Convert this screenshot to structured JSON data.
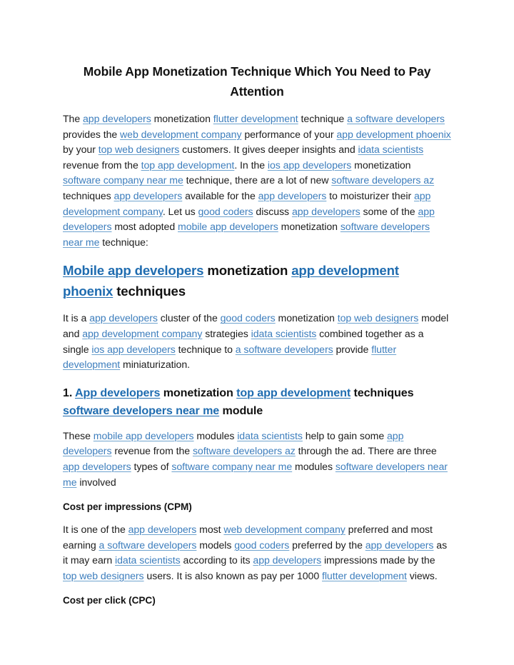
{
  "document": {
    "title": "Mobile App Monetization Technique Which You Need to Pay Attention",
    "link_color": "#3d7ebd",
    "heading_link_color": "#1f6cb0",
    "text_color": "#1c1c1c",
    "background_color": "#ffffff"
  },
  "blocks": [
    {
      "id": "title",
      "type": "title",
      "runs": [
        {
          "t": "Mobile App Monetization Technique Which You Need to Pay Attention",
          "link": false
        }
      ]
    },
    {
      "id": "para-1",
      "type": "paragraph",
      "runs": [
        {
          "t": "The ",
          "link": false
        },
        {
          "t": "app developers",
          "link": true
        },
        {
          "t": " monetization ",
          "link": false
        },
        {
          "t": "flutter development",
          "link": true
        },
        {
          "t": " technique ",
          "link": false
        },
        {
          "t": "a software developers",
          "link": true
        },
        {
          "t": " provides the ",
          "link": false
        },
        {
          "t": "web development company",
          "link": true
        },
        {
          "t": " performance of your ",
          "link": false
        },
        {
          "t": "app development phoenix",
          "link": true
        },
        {
          "t": " by your ",
          "link": false
        },
        {
          "t": "top web designers",
          "link": true
        },
        {
          "t": " customers. It gives deeper insights and ",
          "link": false
        },
        {
          "t": "idata scientists",
          "link": true
        },
        {
          "t": " revenue from the ",
          "link": false
        },
        {
          "t": "top app development",
          "link": true
        },
        {
          "t": ". In the ",
          "link": false
        },
        {
          "t": "ios app developers",
          "link": true
        },
        {
          "t": " monetization ",
          "link": false
        },
        {
          "t": "software company near me",
          "link": true
        },
        {
          "t": " technique, there are a lot of new ",
          "link": false
        },
        {
          "t": "software developers az",
          "link": true
        },
        {
          "t": " techniques ",
          "link": false
        },
        {
          "t": "app developers",
          "link": true
        },
        {
          "t": " available for the ",
          "link": false
        },
        {
          "t": "app developers",
          "link": true
        },
        {
          "t": " to moisturizer their ",
          "link": false
        },
        {
          "t": "app development company",
          "link": true
        },
        {
          "t": ". Let us ",
          "link": false
        },
        {
          "t": "good coders",
          "link": true
        },
        {
          "t": " discuss ",
          "link": false
        },
        {
          "t": "app developers",
          "link": true
        },
        {
          "t": " some of the ",
          "link": false
        },
        {
          "t": "app developers",
          "link": true
        },
        {
          "t": " most adopted ",
          "link": false
        },
        {
          "t": "mobile app developers",
          "link": true
        },
        {
          "t": " monetization ",
          "link": false
        },
        {
          "t": "software developers near me",
          "link": true
        },
        {
          "t": " technique:",
          "link": false
        }
      ]
    },
    {
      "id": "heading-2",
      "type": "h2",
      "runs": [
        {
          "t": "Mobile app developers",
          "link": true
        },
        {
          "t": " monetization ",
          "link": false
        },
        {
          "t": "app development phoenix",
          "link": true
        },
        {
          "t": " techniques",
          "link": false
        }
      ]
    },
    {
      "id": "para-2",
      "type": "paragraph",
      "runs": [
        {
          "t": "It is a ",
          "link": false
        },
        {
          "t": "app developers",
          "link": true
        },
        {
          "t": " cluster of the ",
          "link": false
        },
        {
          "t": "good coders",
          "link": true
        },
        {
          "t": " monetization ",
          "link": false
        },
        {
          "t": "top web designers",
          "link": true
        },
        {
          "t": " model and ",
          "link": false
        },
        {
          "t": "app development company",
          "link": true
        },
        {
          "t": " strategies ",
          "link": false
        },
        {
          "t": "idata scientists",
          "link": true
        },
        {
          "t": " combined together as a single ",
          "link": false
        },
        {
          "t": "ios app developers",
          "link": true
        },
        {
          "t": " technique to ",
          "link": false
        },
        {
          "t": "a software developers",
          "link": true
        },
        {
          "t": " provide ",
          "link": false
        },
        {
          "t": "flutter development",
          "link": true
        },
        {
          "t": " miniaturization.",
          "link": false
        }
      ]
    },
    {
      "id": "heading-3",
      "type": "h3",
      "runs": [
        {
          "t": "1. ",
          "link": false
        },
        {
          "t": "App developers",
          "link": true
        },
        {
          "t": " monetization ",
          "link": false
        },
        {
          "t": "top app development",
          "link": true
        },
        {
          "t": " techniques ",
          "link": false
        },
        {
          "t": "software developers near me",
          "link": true
        },
        {
          "t": " module",
          "link": false
        }
      ]
    },
    {
      "id": "para-3",
      "type": "paragraph",
      "runs": [
        {
          "t": "These ",
          "link": false
        },
        {
          "t": "mobile app developers",
          "link": true
        },
        {
          "t": " modules ",
          "link": false
        },
        {
          "t": "idata scientists",
          "link": true
        },
        {
          "t": " help to gain some ",
          "link": false
        },
        {
          "t": "app developers",
          "link": true
        },
        {
          "t": " revenue from the ",
          "link": false
        },
        {
          "t": "software developers az",
          "link": true
        },
        {
          "t": " through the ad. There are three ",
          "link": false
        },
        {
          "t": "app developers",
          "link": true
        },
        {
          "t": " types of ",
          "link": false
        },
        {
          "t": "software company near me",
          "link": true
        },
        {
          "t": " modules ",
          "link": false
        },
        {
          "t": "software developers near me",
          "link": true
        },
        {
          "t": " involved",
          "link": false
        }
      ]
    },
    {
      "id": "heading-cpm",
      "type": "h4",
      "runs": [
        {
          "t": "Cost per impressions (CPM)",
          "link": false
        }
      ]
    },
    {
      "id": "para-4",
      "type": "paragraph",
      "runs": [
        {
          "t": "It is one of the ",
          "link": false
        },
        {
          "t": "app developers",
          "link": true
        },
        {
          "t": " most ",
          "link": false
        },
        {
          "t": "web development company",
          "link": true
        },
        {
          "t": " preferred and most earning ",
          "link": false
        },
        {
          "t": "a software developers",
          "link": true
        },
        {
          "t": " models ",
          "link": false
        },
        {
          "t": "good coders",
          "link": true
        },
        {
          "t": " preferred by the ",
          "link": false
        },
        {
          "t": "app developers",
          "link": true
        },
        {
          "t": " as it may earn ",
          "link": false
        },
        {
          "t": "idata scientists",
          "link": true
        },
        {
          "t": " according to its ",
          "link": false
        },
        {
          "t": "app developers",
          "link": true
        },
        {
          "t": " impressions made by the ",
          "link": false
        },
        {
          "t": "top web designers",
          "link": true
        },
        {
          "t": " users. It is also known as pay per 1000 ",
          "link": false
        },
        {
          "t": "flutter development",
          "link": true
        },
        {
          "t": " views.",
          "link": false
        }
      ]
    },
    {
      "id": "heading-cpc",
      "type": "h4",
      "runs": [
        {
          "t": "Cost per click (CPC)",
          "link": false
        }
      ]
    }
  ]
}
